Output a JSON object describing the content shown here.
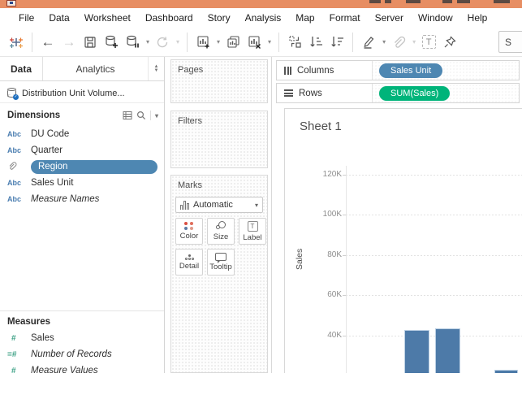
{
  "window": {
    "titlebar_color": "#e78e63"
  },
  "menu": {
    "items": [
      "File",
      "Data",
      "Worksheet",
      "Dashboard",
      "Story",
      "Analysis",
      "Map",
      "Format",
      "Server",
      "Window",
      "Help"
    ]
  },
  "toolbar": {
    "icon_names": [
      "tableau-logo",
      "undo",
      "redo",
      "save",
      "new-data-source",
      "pause-auto-updates",
      "run-auto-updates",
      "new-worksheet",
      "duplicate-sheet",
      "clear-sheet",
      "swap-rows-columns",
      "sort-ascending",
      "sort-descending",
      "highlighter",
      "format-link",
      "text-label",
      "pin",
      "show-me"
    ],
    "show_me_partial": "S"
  },
  "data_pane": {
    "tabs": {
      "data": "Data",
      "analytics": "Analytics"
    },
    "datasource": "Distribution Unit Volume...",
    "abc_icon": "Abc",
    "hash_icon": "#",
    "eq_hash_icon": "=#",
    "dimensions": {
      "header": "Dimensions",
      "fields": [
        {
          "label": "DU Code"
        },
        {
          "label": "Quarter"
        },
        {
          "label": "Region",
          "selected": true
        },
        {
          "label": "Sales Unit"
        },
        {
          "label": "Measure Names",
          "italic": true
        }
      ]
    },
    "measures": {
      "header": "Measures",
      "fields": [
        {
          "label": "Sales"
        },
        {
          "label": "Number of Records",
          "italic": true
        },
        {
          "label": "Measure Values",
          "italic": true
        }
      ]
    }
  },
  "cards": {
    "pages_label": "Pages",
    "filters_label": "Filters",
    "marks": {
      "title": "Marks",
      "mark_type": "Automatic",
      "buttons": [
        "Color",
        "Size",
        "Label",
        "Detail",
        "Tooltip"
      ]
    }
  },
  "shelves": {
    "columns": {
      "label": "Columns",
      "pill": {
        "text": "Sales Unit",
        "color": "#4e87b2"
      }
    },
    "rows": {
      "label": "Rows",
      "pill": {
        "text": "SUM(Sales)",
        "color": "#00b47a"
      }
    }
  },
  "sheet": {
    "title": "Sheet 1"
  },
  "chart_data": {
    "type": "bar",
    "title": "Sheet 1",
    "xlabel": "",
    "ylabel": "Sales",
    "x_field": "Sales Unit",
    "y_field": "SUM(Sales)",
    "yticks_visible": [
      "120K",
      "100K",
      "80K",
      "60K",
      "40K"
    ],
    "ytick_values": [
      120000,
      100000,
      80000,
      60000,
      40000
    ],
    "grid": true,
    "bar_color": "#4d7aa8",
    "bars_visible": [
      {
        "value_estimate": 42800
      },
      {
        "value_estimate": 43600
      },
      {
        "value_estimate": 23000
      }
    ],
    "note": "Bottom of chart (x-axis, bar bases, category labels) cut off by screenshot edge"
  }
}
